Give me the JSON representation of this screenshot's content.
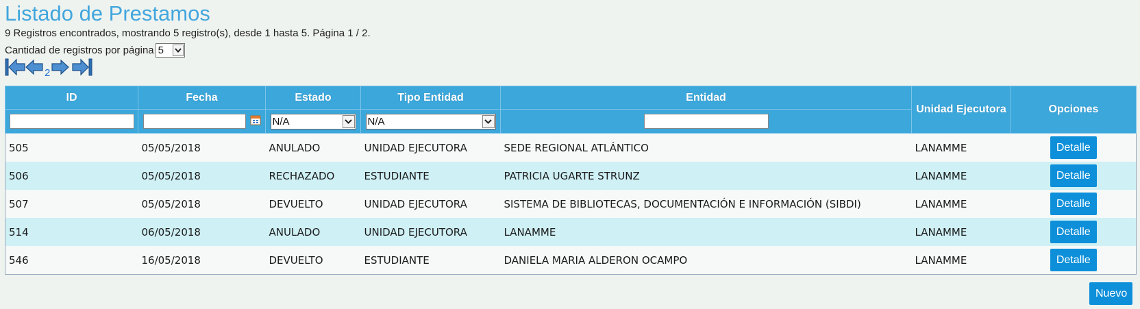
{
  "title": "Listado de Prestamos",
  "summary": "9 Registros encontrados, mostrando 5 registro(s), desde 1 hasta 5. Página 1 / 2.",
  "per_page": {
    "label": "Cantidad de registros por página",
    "value": "5"
  },
  "pager": {
    "current_page": "2"
  },
  "table": {
    "columns": [
      "ID",
      "Fecha",
      "Estado",
      "Tipo Entidad",
      "Entidad",
      "Unidad Ejecutora",
      "Opciones"
    ],
    "filters": {
      "estado": "N/A",
      "tipo_entidad": "N/A"
    },
    "rows": [
      {
        "id": "505",
        "fecha": "05/05/2018",
        "estado": "ANULADO",
        "tipo": "UNIDAD EJECUTORA",
        "entidad": "SEDE REGIONAL ATLÁNTICO",
        "unidad": "LANAMME",
        "action": "Detalle"
      },
      {
        "id": "506",
        "fecha": "05/05/2018",
        "estado": "RECHAZADO",
        "tipo": "ESTUDIANTE",
        "entidad": "PATRICIA UGARTE STRUNZ",
        "unidad": "LANAMME",
        "action": "Detalle"
      },
      {
        "id": "507",
        "fecha": "05/05/2018",
        "estado": "DEVUELTO",
        "tipo": "UNIDAD EJECUTORA",
        "entidad": "SISTEMA DE BIBLIOTECAS, DOCUMENTACIÓN E INFORMACIÓN (SIBDI)",
        "unidad": "LANAMME",
        "action": "Detalle"
      },
      {
        "id": "514",
        "fecha": "06/05/2018",
        "estado": "ANULADO",
        "tipo": "UNIDAD EJECUTORA",
        "entidad": "LANAMME",
        "unidad": "LANAMME",
        "action": "Detalle"
      },
      {
        "id": "546",
        "fecha": "16/05/2018",
        "estado": "DEVUELTO",
        "tipo": "ESTUDIANTE",
        "entidad": "DANIELA MARIA ALDERON OCAMPO",
        "unidad": "LANAMME",
        "action": "Detalle"
      }
    ]
  },
  "new_button": "Nuevo",
  "icons": {
    "pager_first": "first-page-icon",
    "pager_prev": "previous-page-icon",
    "pager_next": "next-page-icon",
    "pager_last": "last-page-icon",
    "date_picker": "calendar-icon",
    "dropdown": "chevron-down-icon"
  },
  "colors": {
    "title": "#42a6dd",
    "header_bg": "#3ba7db",
    "row_alt": "#cff0f5",
    "button": "#0e8fd9"
  }
}
